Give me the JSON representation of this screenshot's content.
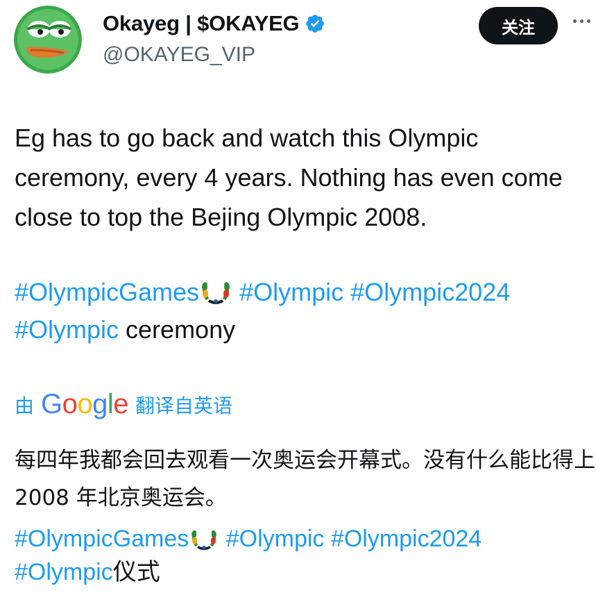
{
  "author": {
    "display_name": "Okayeg | $OKAYEG",
    "handle": "@OKAYEG_VIP",
    "verified_color": "#1d9bf0",
    "avatar_icon": "frog-avatar-icon"
  },
  "actions": {
    "follow_label": "关注",
    "more_icon": "more-icon"
  },
  "tweet": {
    "text": "Eg has to go back and watch this Olympic ceremony, every 4 years. Nothing has even come close to top the Bejing Olympic 2008.",
    "hashtags": {
      "tag1": "#OlympicGames",
      "tag2": "#Olympic",
      "tag3": "#Olympic2024",
      "tag4": "#Olympic",
      "tail": " ceremony"
    }
  },
  "translation": {
    "prefix": "由",
    "provider": "Google",
    "suffix": "翻译自英语",
    "text": "每四年我都会回去观看一次奥运会开幕式。没有什么能比得上 2008 年北京奥运会。",
    "hashtags": {
      "tag1": "#OlympicGames",
      "tag2": "#Olympic",
      "tag3": "#Olympic2024",
      "tag4": "#Olympic",
      "tail": "仪式"
    }
  },
  "colors": {
    "link": "#1d9bf0",
    "text": "#0f1419",
    "secondary": "#536471",
    "button_bg": "#0f1419"
  }
}
